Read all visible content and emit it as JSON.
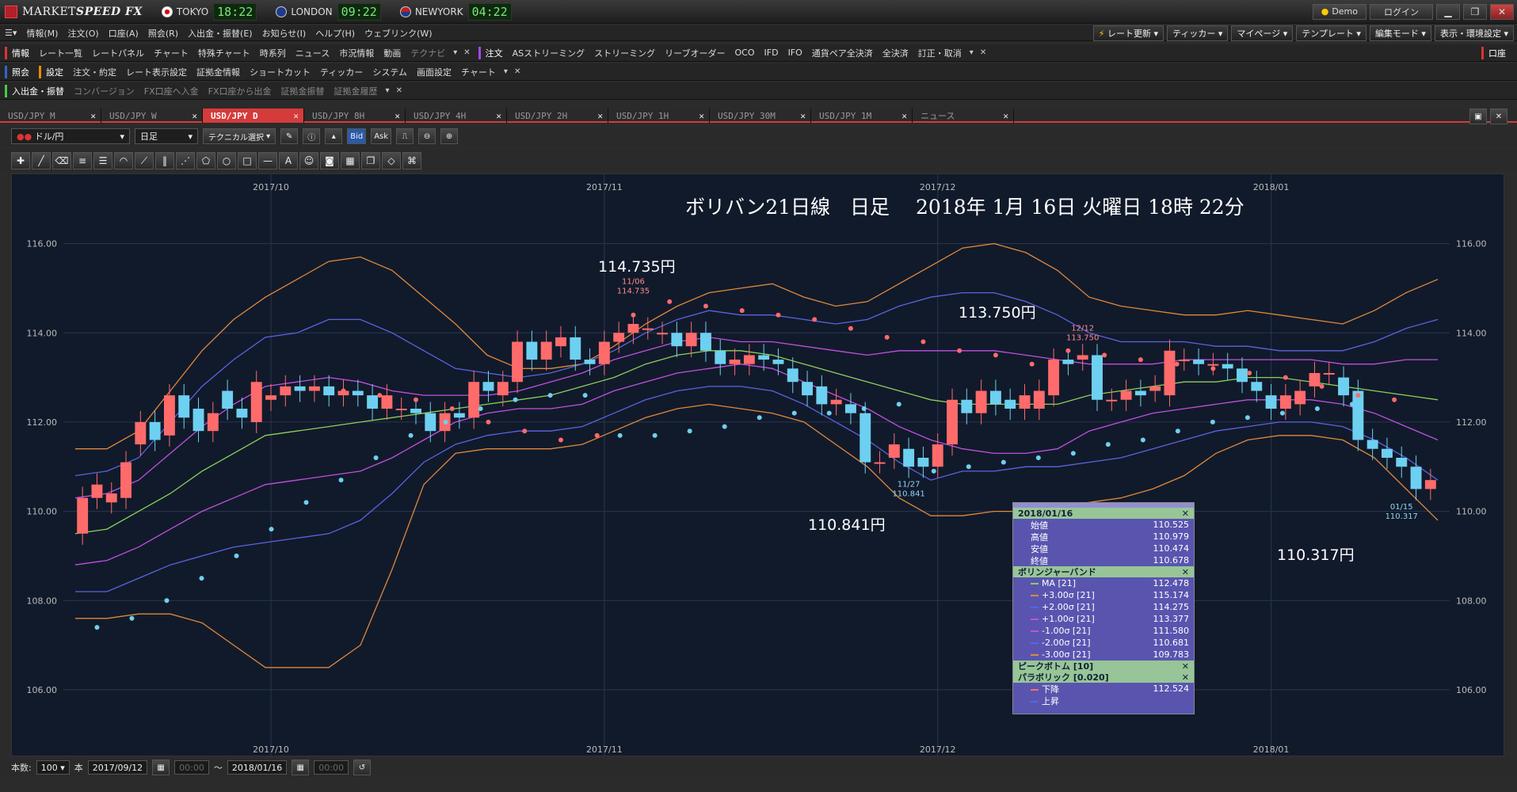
{
  "app": {
    "brand_prefix": "MARKET",
    "brand_suffix": "SPEED FX"
  },
  "clocks": [
    {
      "city": "TOKYO",
      "time": "18:22"
    },
    {
      "city": "LONDON",
      "time": "09:22"
    },
    {
      "city": "NEWYORK",
      "time": "04:22"
    }
  ],
  "titlebar": {
    "demo": "Demo",
    "login": "ログイン"
  },
  "menubar": {
    "items": [
      "情報(M)",
      "注文(O)",
      "口座(A)",
      "照会(R)",
      "入出金・振替(E)",
      "お知らせ(I)",
      "ヘルプ(H)",
      "ウェブリンク(W)"
    ],
    "right": [
      "レート更新",
      "ティッカー",
      "マイページ",
      "テンプレート",
      "編集モード",
      "表示・環境設定"
    ]
  },
  "row1": {
    "cat1": "情報",
    "items1": [
      "レート一覧",
      "レートパネル",
      "チャート",
      "特殊チャート",
      "時系列",
      "ニュース",
      "市況情報",
      "動画",
      "テクナビ"
    ],
    "cat2": "注文",
    "items2": [
      "ASストリーミング",
      "ストリーミング",
      "リーブオーダー",
      "OCO",
      "IFD",
      "IFO",
      "通貨ペア全決済",
      "全決済",
      "訂正・取消"
    ],
    "right": "口座"
  },
  "row2": {
    "cat1": "照会",
    "cat2": "設定",
    "items2": [
      "注文・約定",
      "レート表示設定",
      "証拠金情報",
      "ショートカット",
      "ティッカー",
      "システム",
      "画面設定",
      "チャート"
    ]
  },
  "row3": {
    "cat1": "入出金・振替",
    "items": [
      "コンバージョン",
      "FX口座へ入金",
      "FX口座から出金",
      "証拠金振替",
      "証拠金履歴"
    ]
  },
  "tabs": [
    "USD/JPY M",
    "USD/JPY W",
    "USD/JPY D",
    "USD/JPY 8H",
    "USD/JPY 4H",
    "USD/JPY 2H",
    "USD/JPY 1H",
    "USD/JPY 30M",
    "USD/JPY 1M",
    "ニュース"
  ],
  "active_tab": 2,
  "controls": {
    "pair": "ドル/円",
    "period": "日足",
    "tech": "テクニカル選択",
    "bid": "Bid",
    "ask": "Ask"
  },
  "chart_title": "ボリバン21日線　日足　 2018年 1月 16日 火曜日 18時 22分",
  "annotations": {
    "a1": "114.735円",
    "a2": "113.750円",
    "a3": "110.841円",
    "a4": "110.317円"
  },
  "marks": {
    "m1_date": "11/06",
    "m1_val": "114.735",
    "m2_date": "12/12",
    "m2_val": "113.750",
    "m3_date": "11/27",
    "m3_val": "110.841",
    "m4_date": "01/15",
    "m4_val": "110.317"
  },
  "chart_data": {
    "type": "candlestick",
    "instrument": "USD/JPY",
    "timeframe": "日足",
    "x_ticks": [
      "2017/10",
      "2017/11",
      "2017/12",
      "2018/01"
    ],
    "y_ticks": [
      "106.00",
      "108.00",
      "110.00",
      "112.00",
      "114.00",
      "116.00"
    ],
    "ylim": [
      105.2,
      117.2
    ],
    "candles": [
      [
        109.5,
        110.3
      ],
      [
        110.3,
        110.6
      ],
      [
        110.2,
        110.4
      ],
      [
        110.3,
        111.1
      ],
      [
        111.5,
        112.0
      ],
      [
        112.0,
        111.6
      ],
      [
        111.7,
        112.6
      ],
      [
        112.6,
        112.1
      ],
      [
        112.3,
        111.8
      ],
      [
        111.8,
        112.2
      ],
      [
        112.7,
        112.3
      ],
      [
        112.3,
        112.1
      ],
      [
        112.0,
        112.9
      ],
      [
        112.5,
        112.6
      ],
      [
        112.6,
        112.8
      ],
      [
        112.8,
        112.7
      ],
      [
        112.7,
        112.8
      ],
      [
        112.8,
        112.6
      ],
      [
        112.6,
        112.7
      ],
      [
        112.7,
        112.6
      ],
      [
        112.6,
        112.3
      ],
      [
        112.3,
        112.6
      ],
      [
        112.3,
        112.3
      ],
      [
        112.3,
        112.2
      ],
      [
        112.2,
        111.8
      ],
      [
        111.8,
        112.2
      ],
      [
        112.2,
        112.1
      ],
      [
        112.1,
        112.9
      ],
      [
        112.9,
        112.7
      ],
      [
        112.6,
        112.9
      ],
      [
        112.9,
        113.8
      ],
      [
        113.8,
        113.4
      ],
      [
        113.4,
        113.8
      ],
      [
        113.7,
        113.9
      ],
      [
        113.9,
        113.4
      ],
      [
        113.4,
        113.3
      ],
      [
        113.3,
        113.8
      ],
      [
        113.8,
        114.0
      ],
      [
        114.0,
        114.2
      ],
      [
        114.1,
        114.1
      ],
      [
        114.0,
        114.0
      ],
      [
        114.0,
        113.7
      ],
      [
        113.7,
        114.0
      ],
      [
        114.0,
        113.6
      ],
      [
        113.6,
        113.3
      ],
      [
        113.3,
        113.4
      ],
      [
        113.3,
        113.5
      ],
      [
        113.5,
        113.4
      ],
      [
        113.4,
        113.3
      ],
      [
        113.2,
        112.9
      ],
      [
        112.9,
        112.6
      ],
      [
        112.8,
        112.4
      ],
      [
        112.4,
        112.5
      ],
      [
        112.4,
        112.2
      ],
      [
        112.2,
        111.1
      ],
      [
        111.1,
        111.1
      ],
      [
        111.2,
        111.5
      ],
      [
        111.4,
        111.0
      ],
      [
        111.2,
        111.0
      ],
      [
        111.0,
        111.5
      ],
      [
        111.5,
        112.5
      ],
      [
        112.5,
        112.2
      ],
      [
        112.2,
        112.7
      ],
      [
        112.7,
        112.4
      ],
      [
        112.5,
        112.3
      ],
      [
        112.3,
        112.6
      ],
      [
        112.3,
        112.7
      ],
      [
        112.6,
        113.4
      ],
      [
        113.4,
        113.3
      ],
      [
        113.4,
        113.5
      ],
      [
        113.5,
        112.5
      ],
      [
        112.5,
        112.5
      ],
      [
        112.5,
        112.7
      ],
      [
        112.7,
        112.6
      ],
      [
        112.7,
        112.8
      ],
      [
        112.6,
        113.6
      ],
      [
        113.4,
        113.4
      ],
      [
        113.4,
        113.3
      ],
      [
        113.3,
        113.3
      ],
      [
        113.3,
        113.2
      ],
      [
        113.2,
        112.9
      ],
      [
        112.9,
        112.7
      ],
      [
        112.6,
        112.3
      ],
      [
        112.3,
        112.6
      ],
      [
        112.4,
        112.7
      ],
      [
        112.8,
        113.1
      ],
      [
        113.1,
        113.1
      ],
      [
        113.0,
        112.6
      ],
      [
        112.7,
        111.6
      ],
      [
        111.6,
        111.4
      ],
      [
        111.4,
        111.2
      ],
      [
        111.2,
        111.0
      ],
      [
        111.0,
        110.5
      ],
      [
        110.5,
        110.7
      ]
    ],
    "series": [
      {
        "name": "+3.00σ [21]",
        "color": "#e0883a",
        "values": [
          111.4,
          111.4,
          111.8,
          112.7,
          113.6,
          114.3,
          114.8,
          115.2,
          115.6,
          115.7,
          115.4,
          114.8,
          114.2,
          113.5,
          113.2,
          113.2,
          113.3,
          113.7,
          114.2,
          114.6,
          114.9,
          115.0,
          115.1,
          114.8,
          114.6,
          114.7,
          115.1,
          115.5,
          115.9,
          116.0,
          115.8,
          115.4,
          114.8,
          114.6,
          114.5,
          114.4,
          114.4,
          114.5,
          114.4,
          114.3,
          114.2,
          114.5,
          114.9,
          115.2
        ]
      },
      {
        "name": "+2.00σ [21]",
        "color": "#5b63e0",
        "values": [
          110.8,
          110.9,
          111.2,
          112.0,
          112.8,
          113.4,
          113.9,
          114.0,
          114.3,
          114.3,
          114.0,
          113.6,
          113.2,
          113.1,
          113.0,
          113.1,
          113.3,
          113.6,
          114.0,
          114.3,
          114.5,
          114.4,
          114.4,
          114.3,
          114.2,
          114.3,
          114.6,
          114.8,
          114.9,
          114.9,
          114.7,
          114.4,
          114.0,
          113.8,
          113.8,
          113.8,
          113.7,
          113.7,
          113.6,
          113.6,
          113.6,
          113.8,
          114.1,
          114.3
        ]
      },
      {
        "name": "+1.00σ [21]",
        "color": "#c050e0",
        "values": [
          110.3,
          110.4,
          110.7,
          111.3,
          111.9,
          112.4,
          112.8,
          112.9,
          113.0,
          112.9,
          112.7,
          112.6,
          112.6,
          112.6,
          112.7,
          112.9,
          113.1,
          113.4,
          113.6,
          113.8,
          113.9,
          113.8,
          113.8,
          113.7,
          113.6,
          113.5,
          113.6,
          113.6,
          113.6,
          113.6,
          113.5,
          113.4,
          113.3,
          113.3,
          113.3,
          113.4,
          113.4,
          113.4,
          113.4,
          113.4,
          113.3,
          113.3,
          113.4,
          113.4
        ]
      },
      {
        "name": "MA [21]",
        "color": "#8bd05a",
        "values": [
          109.5,
          109.6,
          110.0,
          110.4,
          110.9,
          111.3,
          111.7,
          111.8,
          111.9,
          112.0,
          112.1,
          112.2,
          112.3,
          112.4,
          112.5,
          112.6,
          112.8,
          113.0,
          113.3,
          113.5,
          113.6,
          113.6,
          113.5,
          113.3,
          113.1,
          112.9,
          112.7,
          112.5,
          112.4,
          112.4,
          112.4,
          112.4,
          112.6,
          112.7,
          112.8,
          112.9,
          112.9,
          113.0,
          113.0,
          112.9,
          112.8,
          112.7,
          112.6,
          112.5
        ]
      },
      {
        "name": "-1.00σ [21]",
        "color": "#c050e0",
        "values": [
          108.8,
          108.9,
          109.2,
          109.6,
          110.0,
          110.3,
          110.6,
          110.7,
          110.8,
          110.9,
          111.2,
          111.6,
          112.0,
          112.2,
          112.3,
          112.3,
          112.4,
          112.7,
          112.9,
          113.1,
          113.2,
          113.3,
          113.2,
          112.9,
          112.6,
          112.3,
          111.9,
          111.6,
          111.4,
          111.3,
          111.3,
          111.4,
          111.8,
          112.0,
          112.2,
          112.3,
          112.4,
          112.5,
          112.5,
          112.5,
          112.4,
          112.2,
          111.9,
          111.6
        ]
      },
      {
        "name": "-2.00σ [21]",
        "color": "#5b63e0",
        "values": [
          108.2,
          108.2,
          108.5,
          108.8,
          109.0,
          109.2,
          109.3,
          109.4,
          109.5,
          109.8,
          110.4,
          111.1,
          111.5,
          111.7,
          111.8,
          111.8,
          111.9,
          112.2,
          112.5,
          112.7,
          112.8,
          112.8,
          112.7,
          112.4,
          112.0,
          111.6,
          111.1,
          110.7,
          110.9,
          110.9,
          111.0,
          111.0,
          111.1,
          111.2,
          111.4,
          111.6,
          111.8,
          111.9,
          112.0,
          112.0,
          111.9,
          111.6,
          111.2,
          110.7
        ]
      },
      {
        "name": "-3.00σ [21]",
        "color": "#e0883a",
        "values": [
          107.6,
          107.6,
          107.7,
          107.7,
          107.5,
          107.0,
          106.5,
          106.5,
          106.5,
          107.0,
          108.7,
          110.6,
          111.3,
          111.4,
          111.4,
          111.4,
          111.5,
          111.8,
          112.1,
          112.3,
          112.4,
          112.3,
          112.2,
          112.0,
          111.5,
          111.0,
          110.3,
          109.9,
          109.9,
          110.0,
          110.0,
          110.1,
          110.2,
          110.3,
          110.5,
          110.8,
          111.3,
          111.6,
          111.7,
          111.7,
          111.6,
          111.2,
          110.5,
          109.8
        ]
      }
    ],
    "parabolic_down": [
      112.7,
      112.6,
      112.5,
      112.3,
      112.0,
      111.8,
      111.6,
      111.7,
      114.4,
      114.7,
      114.6,
      114.5,
      114.4,
      114.3,
      114.1,
      113.9,
      113.8,
      113.6,
      113.5,
      113.3,
      113.6,
      113.5,
      113.4,
      113.3,
      113.2,
      113.1,
      113.0,
      112.8,
      112.6,
      112.5
    ],
    "parabolic_up": [
      107.4,
      107.6,
      108.0,
      108.5,
      109.0,
      109.6,
      110.2,
      110.7,
      111.2,
      111.7,
      112.0,
      112.3,
      112.5,
      112.6,
      112.6,
      111.7,
      111.7,
      111.8,
      111.9,
      112.1,
      112.2,
      112.2,
      112.3,
      112.4,
      110.9,
      111.0,
      111.1,
      111.2,
      111.3,
      111.5,
      111.6,
      111.8,
      112.0,
      112.1,
      112.2,
      112.3,
      112.4
    ]
  },
  "infopanel": {
    "date": "2018/01/16",
    "ohlc": [
      {
        "label": "始値",
        "value": "110.525"
      },
      {
        "label": "高値",
        "value": "110.979"
      },
      {
        "label": "安値",
        "value": "110.474"
      },
      {
        "label": "終値",
        "value": "110.678"
      }
    ],
    "bb_header": "ボリンジャーバンド",
    "bb": [
      {
        "label": "MA [21]",
        "value": "112.478",
        "color": "#8bd05a"
      },
      {
        "label": "+3.00σ [21]",
        "value": "115.174",
        "color": "#e0883a"
      },
      {
        "label": "+2.00σ [21]",
        "value": "114.275",
        "color": "#5b63e0"
      },
      {
        "label": "+1.00σ [21]",
        "value": "113.377",
        "color": "#c050e0"
      },
      {
        "label": "-1.00σ [21]",
        "value": "111.580",
        "color": "#c050e0"
      },
      {
        "label": "-2.00σ [21]",
        "value": "110.681",
        "color": "#5b63e0"
      },
      {
        "label": "-3.00σ [21]",
        "value": "109.783",
        "color": "#e0883a"
      }
    ],
    "pb_header": "ピークボトム [10]",
    "ps_header": "パラボリック [0.020]",
    "ps": [
      {
        "label": "下降",
        "value": "112.524",
        "color": "#ff6b6b"
      },
      {
        "label": "上昇",
        "value": "",
        "color": "#5b63e0"
      }
    ]
  },
  "bottombar": {
    "count_label": "本数:",
    "count": "100",
    "unit": "本",
    "from": "2017/09/12",
    "from_time": "00:00",
    "tilde": "～",
    "to": "2018/01/16",
    "to_time": "00:00"
  }
}
